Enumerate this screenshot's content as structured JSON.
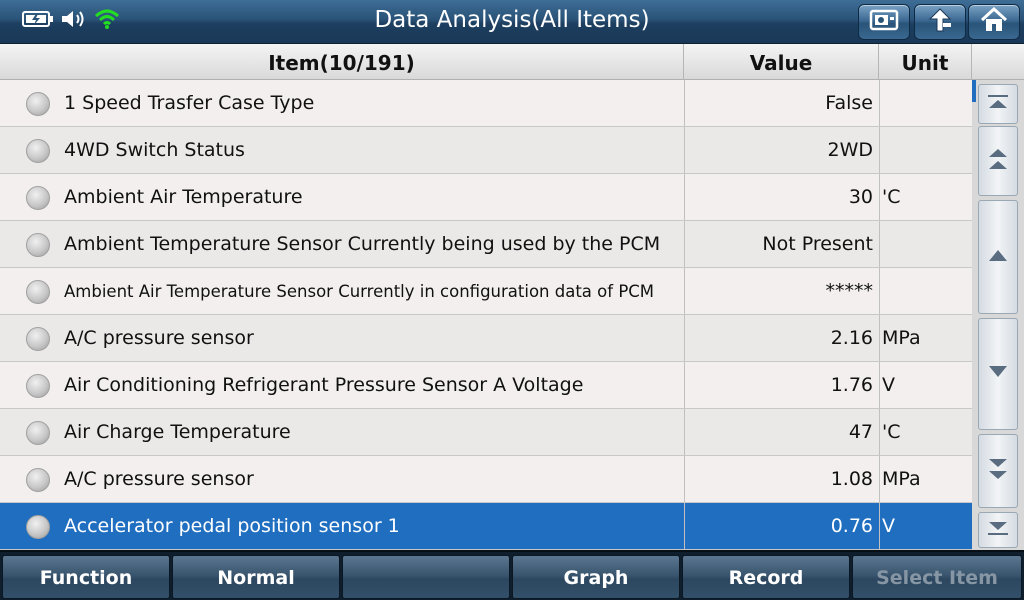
{
  "window": {
    "title": "Data Analysis(All Items)",
    "icons": [
      "battery-icon",
      "speaker-icon",
      "wifi-icon"
    ]
  },
  "nav": {
    "buttons": [
      "screenshot-icon",
      "back-icon",
      "home-icon"
    ]
  },
  "table": {
    "columns": {
      "item": "Item(10/191)",
      "value": "Value",
      "unit": "Unit"
    },
    "rows": [
      {
        "item": "1 Speed Trasfer Case Type",
        "value": "False",
        "unit": ""
      },
      {
        "item": "4WD Switch Status",
        "value": "2WD",
        "unit": ""
      },
      {
        "item": "Ambient Air Temperature",
        "value": "30",
        "unit": "'C"
      },
      {
        "item": "Ambient Temperature Sensor Currently being used by the PCM",
        "value": "Not Present",
        "unit": ""
      },
      {
        "item": "Ambient Air Temperature Sensor Currently in configuration data of PCM",
        "value": "*****",
        "unit": ""
      },
      {
        "item": "A/C pressure sensor",
        "value": "2.16",
        "unit": "MPa"
      },
      {
        "item": "Air Conditioning Refrigerant Pressure Sensor A Voltage",
        "value": "1.76",
        "unit": "V"
      },
      {
        "item": "Air Charge Temperature",
        "value": "47",
        "unit": "'C"
      },
      {
        "item": "A/C pressure sensor",
        "value": "1.08",
        "unit": "MPa"
      },
      {
        "item": "Accelerator pedal position sensor 1",
        "value": "0.76",
        "unit": "V"
      }
    ],
    "selected_row": 9
  },
  "scrollbar": {
    "buttons": [
      "scroll-top-icon",
      "page-up-icon",
      "line-up-icon",
      "line-down-icon",
      "page-down-icon",
      "scroll-bottom-icon"
    ]
  },
  "toolbar": {
    "function": "Function",
    "normal": "Normal",
    "blank": "",
    "graph": "Graph",
    "record": "Record",
    "select_item": "Select Item"
  },
  "colors": {
    "title_bar": "#2a5378",
    "selected_row": "#1f6ec0",
    "wifi": "#22dd22"
  }
}
